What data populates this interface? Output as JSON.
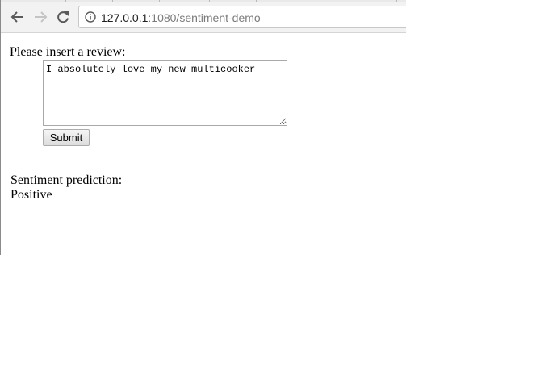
{
  "browser": {
    "url_host": "127.0.0.1",
    "url_path": ":1080/sentiment-demo",
    "back_icon": "back-arrow-icon",
    "forward_icon": "forward-arrow-icon",
    "reload_icon": "reload-icon",
    "info_icon": "info-icon"
  },
  "form": {
    "prompt_label": "Please insert a review:",
    "review_value": "I absolutely love my new multicooker",
    "submit_label": "Submit"
  },
  "result": {
    "label": "Sentiment prediction:",
    "value": "Positive"
  }
}
